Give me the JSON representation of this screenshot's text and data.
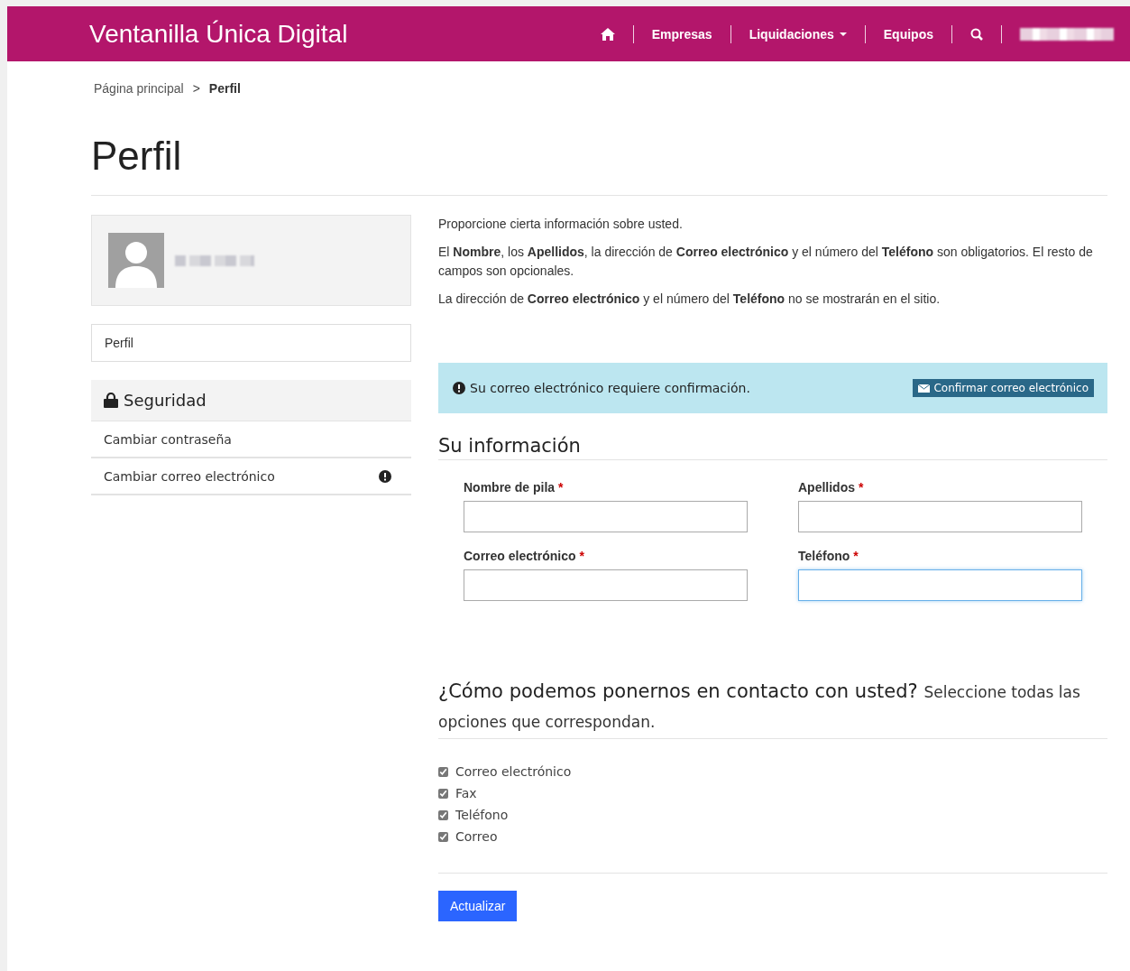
{
  "header": {
    "brand": "Ventanilla Única Digital",
    "nav": [
      {
        "kind": "home"
      },
      {
        "kind": "link",
        "label": "Empresas"
      },
      {
        "kind": "dropdown",
        "label": "Liquidaciones"
      },
      {
        "kind": "link",
        "label": "Equipos"
      },
      {
        "kind": "search"
      },
      {
        "kind": "user"
      }
    ]
  },
  "breadcrumb": [
    {
      "label": "Página principal",
      "current": false
    },
    {
      "label": "Perfil",
      "current": true
    }
  ],
  "breadcrumb_separator": ">",
  "page_title": "Perfil",
  "sidebar": {
    "profile_link": "Perfil",
    "security": {
      "title": "Seguridad",
      "items": [
        {
          "label": "Cambiar contraseña",
          "warning": false
        },
        {
          "label": "Cambiar correo electrónico",
          "warning": true
        }
      ]
    }
  },
  "intro": [
    "Proporcione cierta información sobre usted.",
    "El **Nombre**, los **Apellidos**, la dirección de **Correo electrónico** y el número del **Teléfono** son obligatorios. El resto de campos son opcionales.",
    "La dirección de **Correo electrónico** y el número del **Teléfono** no se mostrarán en el sitio."
  ],
  "alert": {
    "message": "Su correo electrónico requiere confirmación.",
    "button": "Confirmar correo electrónico"
  },
  "info_section": {
    "title": "Su información",
    "fields": [
      {
        "label": "Nombre de pila",
        "required_mark": "*",
        "focused": false
      },
      {
        "label": "Apellidos",
        "required_mark": "*",
        "focused": false
      },
      {
        "label": "Correo electrónico",
        "required_mark": "*",
        "focused": false
      },
      {
        "label": "Teléfono",
        "required_mark": "*",
        "focused": true
      }
    ]
  },
  "contact_section": {
    "title": "¿Cómo podemos ponernos en contacto con usted?",
    "subtitle": "Seleccione todas las opciones que correspondan.",
    "options": [
      {
        "label": "Correo electrónico",
        "checked": true
      },
      {
        "label": "Fax",
        "checked": true
      },
      {
        "label": "Teléfono",
        "checked": true
      },
      {
        "label": "Correo",
        "checked": true
      }
    ]
  },
  "submit": "Actualizar"
}
